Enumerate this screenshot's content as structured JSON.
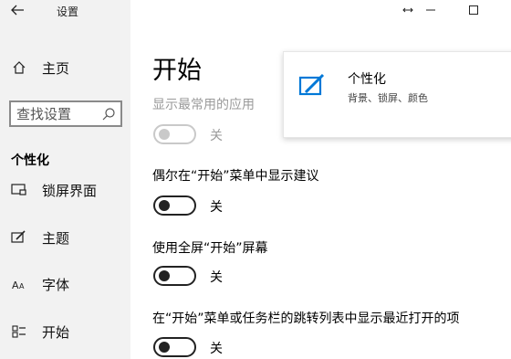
{
  "window": {
    "app_title": "设置",
    "back_icon": "back-arrow-icon",
    "resize_icon": "resize-arrows-icon",
    "minimize_icon": "minimize-icon",
    "maximize_icon": "maximize-icon"
  },
  "sidebar": {
    "home_label": "主页",
    "search_placeholder": "查找设置",
    "section_heading": "个性化",
    "items": [
      {
        "label": "锁屏界面",
        "icon": "lock-screen-icon"
      },
      {
        "label": "主题",
        "icon": "theme-brush-icon"
      },
      {
        "label": "字体",
        "icon": "font-icon"
      },
      {
        "label": "开始",
        "icon": "start-menu-icon"
      }
    ]
  },
  "main": {
    "title": "开始",
    "settings": [
      {
        "label": "显示最常用的应用",
        "state": "关",
        "on": false,
        "disabled": true
      },
      {
        "label": "偶尔在“开始”菜单中显示建议",
        "state": "关",
        "on": false,
        "disabled": false
      },
      {
        "label": "使用全屏“开始”屏幕",
        "state": "关",
        "on": false,
        "disabled": false
      },
      {
        "label": "在“开始”菜单或任务栏的跳转列表中显示最近打开的项",
        "state": "关",
        "on": false,
        "disabled": false
      }
    ]
  },
  "related_card": {
    "title": "个性化",
    "subtitle": "背景、锁屏、颜色",
    "icon": "personalization-icon",
    "accent_color": "#0078d7"
  }
}
